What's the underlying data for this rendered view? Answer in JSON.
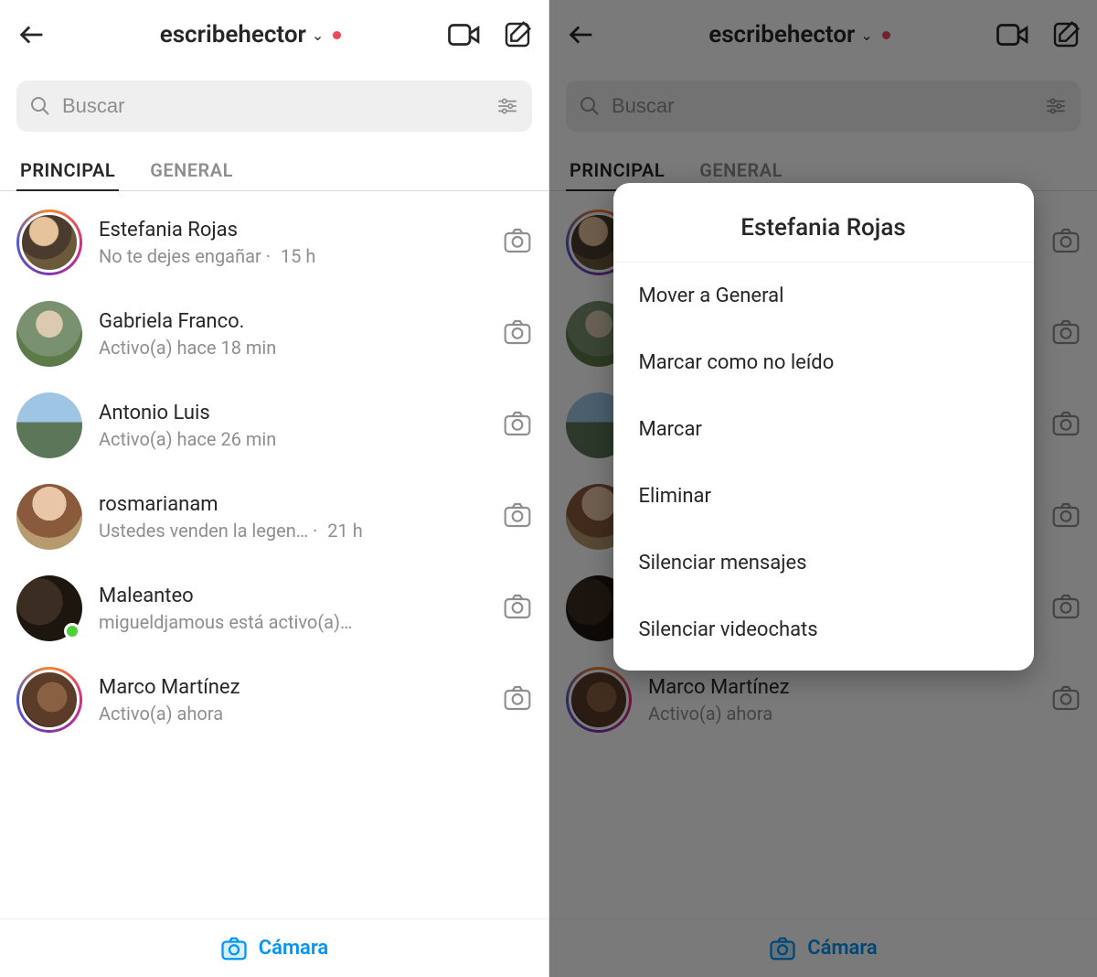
{
  "header": {
    "username": "escribehector"
  },
  "search": {
    "placeholder": "Buscar"
  },
  "tabs": {
    "primary": "PRINCIPAL",
    "general": "GENERAL"
  },
  "chats": [
    {
      "name": "Estefania Rojas",
      "sub": "No te dejes engañar",
      "time": "15 h",
      "show_time": true,
      "ring": true,
      "online": false,
      "av": "av1"
    },
    {
      "name": "Gabriela Franco.",
      "sub": "Activo(a) hace 18 min",
      "time": "",
      "show_time": false,
      "ring": false,
      "online": false,
      "av": "av2"
    },
    {
      "name": "Antonio Luis",
      "sub": "Activo(a) hace 26 min",
      "time": "",
      "show_time": false,
      "ring": false,
      "online": false,
      "av": "av3"
    },
    {
      "name": "rosmarianam",
      "sub": "Ustedes venden la legen…",
      "time": "21 h",
      "show_time": true,
      "ring": false,
      "online": false,
      "av": "av4"
    },
    {
      "name": "Maleanteo",
      "sub": "migueldjamous está activo(a)…",
      "time": "",
      "show_time": false,
      "ring": false,
      "online": true,
      "av": "av5"
    },
    {
      "name": "Marco Martínez",
      "sub": "Activo(a) ahora",
      "time": "",
      "show_time": false,
      "ring": true,
      "online": false,
      "av": "av6"
    }
  ],
  "right_visible_chat": {
    "name": "Marco Martínez",
    "sub": "Activo(a) ahora"
  },
  "bottom": {
    "camera": "Cámara"
  },
  "modal": {
    "title": "Estefania Rojas",
    "items": [
      "Mover a General",
      "Marcar como no leído",
      "Marcar",
      "Eliminar",
      "Silenciar mensajes",
      "Silenciar videochats"
    ]
  }
}
